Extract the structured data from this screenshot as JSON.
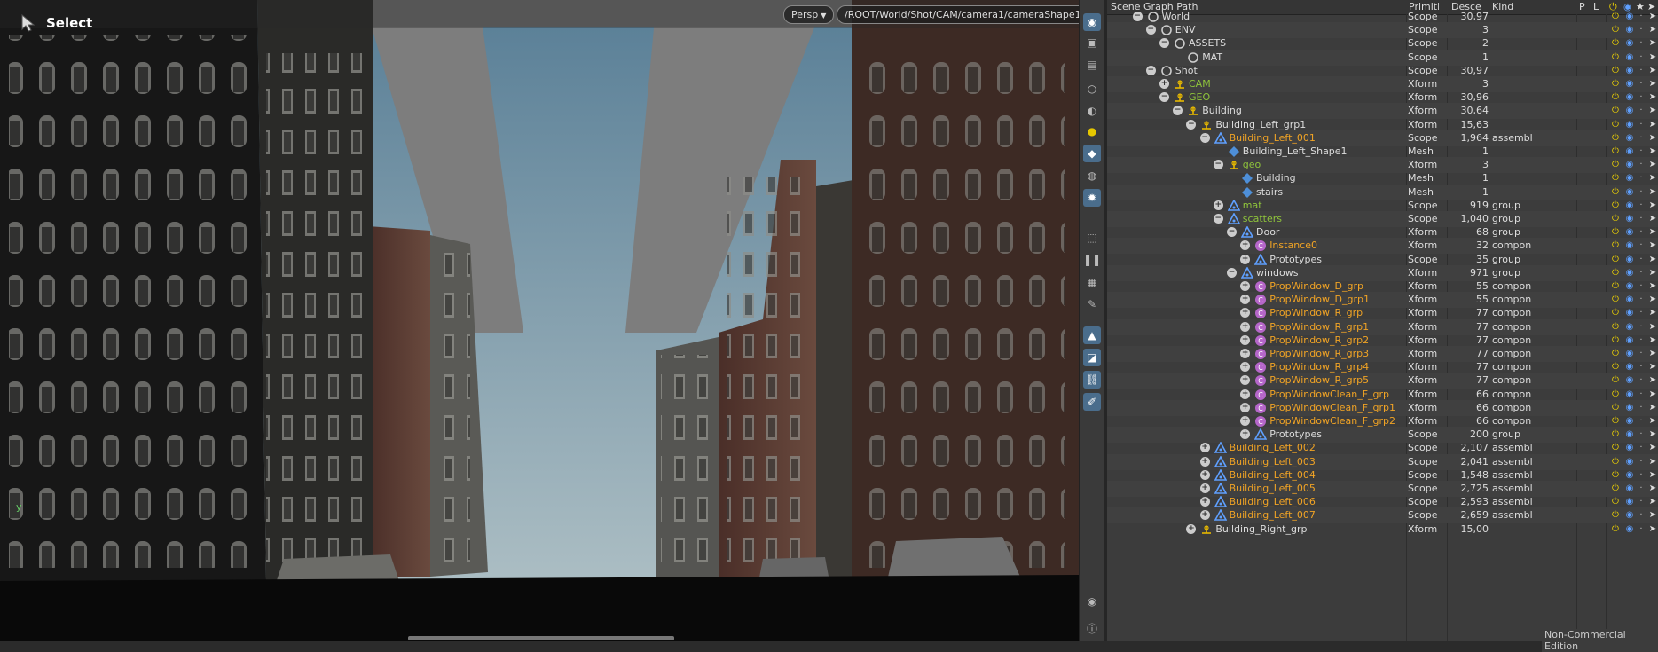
{
  "viewport": {
    "tool_label": "Select",
    "view_mode": "Persp",
    "camera_path": "/ROOT/World/Shot/CAM/camera1/cameraShape1",
    "axis_label": "y"
  },
  "scene_graph": {
    "columns": {
      "path": "Scene Graph Path",
      "primitive": "Primiti",
      "descendants": "Descen",
      "kind": "Kind",
      "p": "P",
      "l": "L"
    },
    "rows": [
      {
        "name": "World",
        "depth": 3,
        "exp": "-",
        "icon": "scope",
        "color": "w",
        "type": "Scope",
        "desc": "30,97",
        "kind": ""
      },
      {
        "name": "ENV",
        "depth": 4,
        "exp": "-",
        "icon": "scope",
        "color": "w",
        "type": "Scope",
        "desc": "3",
        "kind": ""
      },
      {
        "name": "ASSETS",
        "depth": 5,
        "exp": "-",
        "icon": "scope",
        "color": "w",
        "type": "Scope",
        "desc": "2",
        "kind": ""
      },
      {
        "name": "MAT",
        "depth": 6,
        "exp": "",
        "icon": "scope",
        "color": "w",
        "type": "Scope",
        "desc": "1",
        "kind": ""
      },
      {
        "name": "Shot",
        "depth": 4,
        "exp": "-",
        "icon": "scope",
        "color": "w",
        "type": "Scope",
        "desc": "30,97",
        "kind": ""
      },
      {
        "name": "CAM",
        "depth": 5,
        "exp": "+",
        "icon": "xform",
        "color": "g",
        "type": "Xform",
        "desc": "3",
        "kind": ""
      },
      {
        "name": "GEO",
        "depth": 5,
        "exp": "-",
        "icon": "xform",
        "color": "g",
        "type": "Xform",
        "desc": "30,96",
        "kind": ""
      },
      {
        "name": "Building",
        "depth": 6,
        "exp": "-",
        "icon": "xform",
        "color": "w",
        "type": "Xform",
        "desc": "30,64",
        "kind": ""
      },
      {
        "name": "Building_Left_grp1",
        "depth": 7,
        "exp": "-",
        "icon": "xform",
        "color": "w",
        "type": "Xform",
        "desc": "15,63",
        "kind": ""
      },
      {
        "name": "Building_Left_001",
        "depth": 8,
        "exp": "-",
        "icon": "tri",
        "color": "o",
        "type": "Scope",
        "desc": "1,964",
        "kind": "assembl"
      },
      {
        "name": "Building_Left_Shape1",
        "depth": 9,
        "exp": "",
        "icon": "mesh",
        "color": "w",
        "type": "Mesh",
        "desc": "1",
        "kind": ""
      },
      {
        "name": "geo",
        "depth": 9,
        "exp": "-",
        "icon": "xform",
        "color": "g",
        "type": "Xform",
        "desc": "3",
        "kind": ""
      },
      {
        "name": "Building",
        "depth": 10,
        "exp": "",
        "icon": "mesh",
        "color": "w",
        "type": "Mesh",
        "desc": "1",
        "kind": ""
      },
      {
        "name": "stairs",
        "depth": 10,
        "exp": "",
        "icon": "mesh",
        "color": "w",
        "type": "Mesh",
        "desc": "1",
        "kind": ""
      },
      {
        "name": "mat",
        "depth": 9,
        "exp": "+",
        "icon": "tri",
        "color": "g",
        "type": "Scope",
        "desc": "919",
        "kind": "group"
      },
      {
        "name": "scatters",
        "depth": 9,
        "exp": "-",
        "icon": "tri",
        "color": "g",
        "type": "Scope",
        "desc": "1,040",
        "kind": "group"
      },
      {
        "name": "Door",
        "depth": 10,
        "exp": "-",
        "icon": "tri",
        "color": "w",
        "type": "Xform",
        "desc": "68",
        "kind": "group"
      },
      {
        "name": "Instance0",
        "depth": 11,
        "exp": "+",
        "icon": "comp",
        "color": "o",
        "type": "Xform",
        "desc": "32",
        "kind": "compon"
      },
      {
        "name": "Prototypes",
        "depth": 11,
        "exp": "+",
        "icon": "tri",
        "color": "w",
        "type": "Scope",
        "desc": "35",
        "kind": "group"
      },
      {
        "name": "windows",
        "depth": 10,
        "exp": "-",
        "icon": "tri",
        "color": "w",
        "type": "Xform",
        "desc": "971",
        "kind": "group"
      },
      {
        "name": "PropWindow_D_grp",
        "depth": 11,
        "exp": "+",
        "icon": "comp",
        "color": "o",
        "type": "Xform",
        "desc": "55",
        "kind": "compon"
      },
      {
        "name": "PropWindow_D_grp1",
        "depth": 11,
        "exp": "+",
        "icon": "comp",
        "color": "o",
        "type": "Xform",
        "desc": "55",
        "kind": "compon"
      },
      {
        "name": "PropWindow_R_grp",
        "depth": 11,
        "exp": "+",
        "icon": "comp",
        "color": "o",
        "type": "Xform",
        "desc": "77",
        "kind": "compon"
      },
      {
        "name": "PropWindow_R_grp1",
        "depth": 11,
        "exp": "+",
        "icon": "comp",
        "color": "o",
        "type": "Xform",
        "desc": "77",
        "kind": "compon"
      },
      {
        "name": "PropWindow_R_grp2",
        "depth": 11,
        "exp": "+",
        "icon": "comp",
        "color": "o",
        "type": "Xform",
        "desc": "77",
        "kind": "compon"
      },
      {
        "name": "PropWindow_R_grp3",
        "depth": 11,
        "exp": "+",
        "icon": "comp",
        "color": "o",
        "type": "Xform",
        "desc": "77",
        "kind": "compon"
      },
      {
        "name": "PropWindow_R_grp4",
        "depth": 11,
        "exp": "+",
        "icon": "comp",
        "color": "o",
        "type": "Xform",
        "desc": "77",
        "kind": "compon"
      },
      {
        "name": "PropWindow_R_grp5",
        "depth": 11,
        "exp": "+",
        "icon": "comp",
        "color": "o",
        "type": "Xform",
        "desc": "77",
        "kind": "compon"
      },
      {
        "name": "PropWindowClean_F_grp",
        "depth": 11,
        "exp": "+",
        "icon": "comp",
        "color": "o",
        "type": "Xform",
        "desc": "66",
        "kind": "compon"
      },
      {
        "name": "PropWindowClean_F_grp1",
        "depth": 11,
        "exp": "+",
        "icon": "comp",
        "color": "o",
        "type": "Xform",
        "desc": "66",
        "kind": "compon"
      },
      {
        "name": "PropWindowClean_F_grp2",
        "depth": 11,
        "exp": "+",
        "icon": "comp",
        "color": "o",
        "type": "Xform",
        "desc": "66",
        "kind": "compon"
      },
      {
        "name": "Prototypes",
        "depth": 11,
        "exp": "+",
        "icon": "tri",
        "color": "w",
        "type": "Scope",
        "desc": "200",
        "kind": "group"
      },
      {
        "name": "Building_Left_002",
        "depth": 8,
        "exp": "+",
        "icon": "tri",
        "color": "o",
        "type": "Scope",
        "desc": "2,107",
        "kind": "assembl"
      },
      {
        "name": "Building_Left_003",
        "depth": 8,
        "exp": "+",
        "icon": "tri",
        "color": "o",
        "type": "Scope",
        "desc": "2,041",
        "kind": "assembl"
      },
      {
        "name": "Building_Left_004",
        "depth": 8,
        "exp": "+",
        "icon": "tri",
        "color": "o",
        "type": "Scope",
        "desc": "1,548",
        "kind": "assembl"
      },
      {
        "name": "Building_Left_005",
        "depth": 8,
        "exp": "+",
        "icon": "tri",
        "color": "o",
        "type": "Scope",
        "desc": "2,725",
        "kind": "assembl"
      },
      {
        "name": "Building_Left_006",
        "depth": 8,
        "exp": "+",
        "icon": "tri",
        "color": "o",
        "type": "Scope",
        "desc": "2,593",
        "kind": "assembl"
      },
      {
        "name": "Building_Left_007",
        "depth": 8,
        "exp": "+",
        "icon": "tri",
        "color": "o",
        "type": "Scope",
        "desc": "2,659",
        "kind": "assembl"
      },
      {
        "name": "Building_Right_grp",
        "depth": 7,
        "exp": "+",
        "icon": "xform",
        "color": "w",
        "type": "Xform",
        "desc": "15,00",
        "kind": ""
      }
    ]
  },
  "footer": {
    "edition": "Non-Commercial Edition"
  },
  "colors": {
    "highlight_green": "#8fc43b",
    "highlight_orange": "#f0a325",
    "accent_blue": "#4a6d8c"
  }
}
